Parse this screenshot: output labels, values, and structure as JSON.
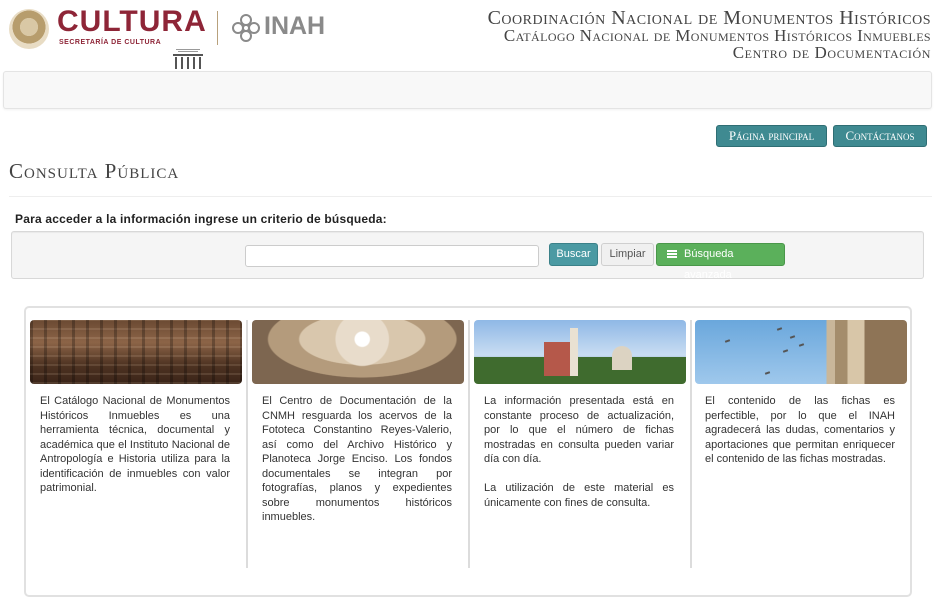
{
  "header": {
    "logo_cultura": "CULTURA",
    "logo_cultura_sub": "SECRETARÍA DE CULTURA",
    "logo_inah": "INAH",
    "title_line1": "Coordinación Nacional de Monumentos Históricos",
    "title_line2": "Catálogo Nacional de Monumentos Históricos Inmuebles",
    "title_line3": "Centro de Documentación"
  },
  "nav": {
    "home_label": "Página principal",
    "contact_label": "Contáctanos"
  },
  "page": {
    "title": "Consulta Pública",
    "prompt": "Para acceder a la información ingrese un criterio de búsqueda:"
  },
  "search": {
    "value": "",
    "placeholder": "",
    "search_label": "Buscar",
    "clear_label": "Limpiar",
    "advanced_label": "Búsqueda avanzada"
  },
  "info": {
    "col1": "El Catálogo Nacional de Monumentos Históricos Inmuebles es una herramienta técnica, documental y académica que el Instituto Nacional de Antropología e Historia utiliza para la identificación de inmuebles con valor patrimonial.",
    "col2": "El Centro de Documentación de la CNMH resguarda los acervos de la Fototeca Constantino Reyes-Valerio, así como del Archivo Histórico y Planoteca Jorge Enciso. Los fondos documentales se integran por fotografías, planos y expedientes sobre monumentos históricos inmuebles.",
    "col3_p1": "La información presentada está en constante proceso de actualización, por lo que el número de fichas mostradas en consulta pueden variar día con día.",
    "col3_p2": "La utilización de este material es únicamente con fines de consulta.",
    "col4": "El contenido de las fichas es perfectible, por lo que el INAH agradecerá las dudas, comentarios y aportaciones que permitan enriquecer el contenido de las fichas mostradas."
  },
  "colors": {
    "cultura_red": "#8e2537",
    "teal_button": "#3f8a91",
    "green_button": "#5bb05b"
  }
}
